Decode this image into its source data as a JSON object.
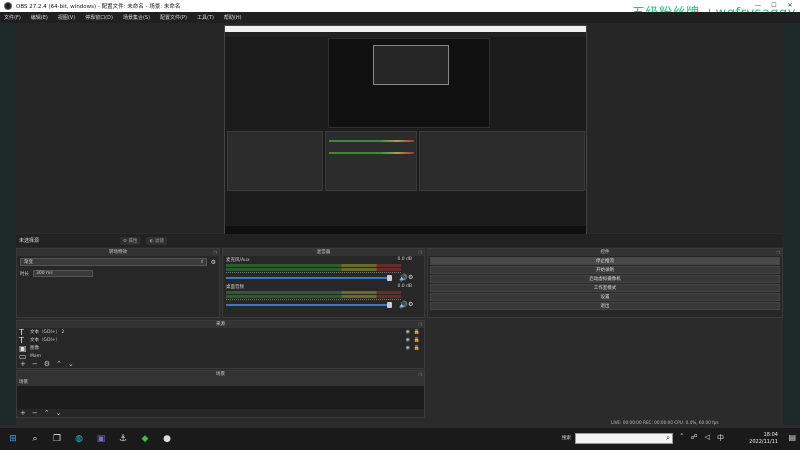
{
  "window": {
    "title": "OBS 27.2.4 (64-bit, windows) - 配置文件: 未命名 - 场景: 未命名",
    "minimize": "—",
    "maximize": "☐",
    "close": "✕"
  },
  "watermark": "五级粉丝牌 +wqfrysaggy",
  "menu": [
    "文件(F)",
    "编辑(E)",
    "视图(V)",
    "停靠窗口(D)",
    "场景集合(S)",
    "配置文件(P)",
    "工具(T)",
    "帮助(H)"
  ],
  "status": {
    "selection": "未选择源",
    "properties_button": "属性",
    "filters_button": "滤镜"
  },
  "transitions": {
    "header": "转场特效",
    "selected": "渐变",
    "duration_label": "时长",
    "duration_value": "300 ms"
  },
  "mixer": {
    "header": "混音器",
    "channels": [
      {
        "name": "麦克风/Aux",
        "db": "0.0 dB"
      },
      {
        "name": "桌面音频",
        "db": "0.0 dB"
      }
    ]
  },
  "controls": {
    "header": "控件",
    "buttons": [
      "停止推流",
      "开始录制",
      "启动虚拟摄像机",
      "工作室模式",
      "设置",
      "退出"
    ]
  },
  "sources": {
    "header": "来源",
    "items": [
      {
        "name": "文本（GDI+） 2",
        "icon": "text-icon"
      },
      {
        "name": "文本（GDI+）",
        "icon": "text-icon"
      },
      {
        "name": "图像",
        "icon": "image-icon"
      },
      {
        "name": "Mam",
        "icon": "window-icon"
      }
    ]
  },
  "scenes": {
    "header": "场景",
    "items": [
      "场景"
    ]
  },
  "stats": "LIVE: 00:00:00   REC: 00:00:00   CPU: 0.4%, 60.00 fps",
  "taskbar": {
    "search_label": "搜索",
    "time": "18:04",
    "date": "2022/11/11"
  }
}
